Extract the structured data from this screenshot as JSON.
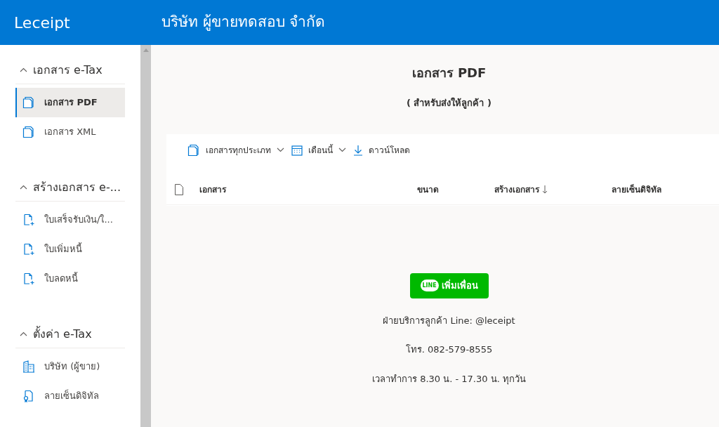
{
  "header": {
    "brand": "Leceipt",
    "company": "บริษัท ผู้ขายทดสอบ จำกัด"
  },
  "sidebar": {
    "groups": [
      {
        "title": "เอกสาร e-Tax",
        "expanded": true,
        "items": [
          {
            "label": "เอกสาร PDF",
            "kind": "document",
            "selected": true
          },
          {
            "label": "เอกสาร XML",
            "kind": "document",
            "selected": false
          }
        ]
      },
      {
        "title": "สร้างเอกสาร e-...",
        "expanded": true,
        "items": [
          {
            "label": "ใบเสร็จรับเงิน/ใ...",
            "kind": "new",
            "selected": false
          },
          {
            "label": "ใบเพิ่มหนี้",
            "kind": "new",
            "selected": false
          },
          {
            "label": "ใบลดหนี้",
            "kind": "new",
            "selected": false
          }
        ]
      },
      {
        "title": "ตั้งค่า e-Tax",
        "expanded": true,
        "items": [
          {
            "label": "บริษัท (ผู้ขาย)",
            "kind": "building",
            "selected": false
          },
          {
            "label": "ลายเซ็นดิจิทัล",
            "kind": "certificate",
            "selected": false
          }
        ]
      }
    ]
  },
  "main": {
    "title": "เอกสาร PDF",
    "subtitle": "( สำหรับส่งให้ลูกค้า )",
    "toolbar": [
      {
        "label": "เอกสารทุกประเภท",
        "kind": "document",
        "dropdown": true
      },
      {
        "label": "เดือนนี้",
        "kind": "calendar",
        "dropdown": true
      },
      {
        "label": "ดาวน์โหลด",
        "kind": "download",
        "dropdown": false
      }
    ],
    "table": {
      "columns": [
        {
          "label": "เอกสาร",
          "sorted": false
        },
        {
          "label": "ขนาด",
          "sorted": false
        },
        {
          "label": "สร้างเอกสาร",
          "sorted": true
        },
        {
          "label": "ลายเซ็นดิจิทัล",
          "sorted": false
        }
      ]
    },
    "contact": {
      "button": {
        "logo": "LINE",
        "label": "เพิ่มเพื่อน"
      },
      "lines": [
        "ฝ่ายบริการลูกค้า Line: @leceipt",
        "โทร. 082-579-8555",
        "เวลาทำการ 8.30 น. - 17.30 น. ทุกวัน"
      ]
    }
  }
}
